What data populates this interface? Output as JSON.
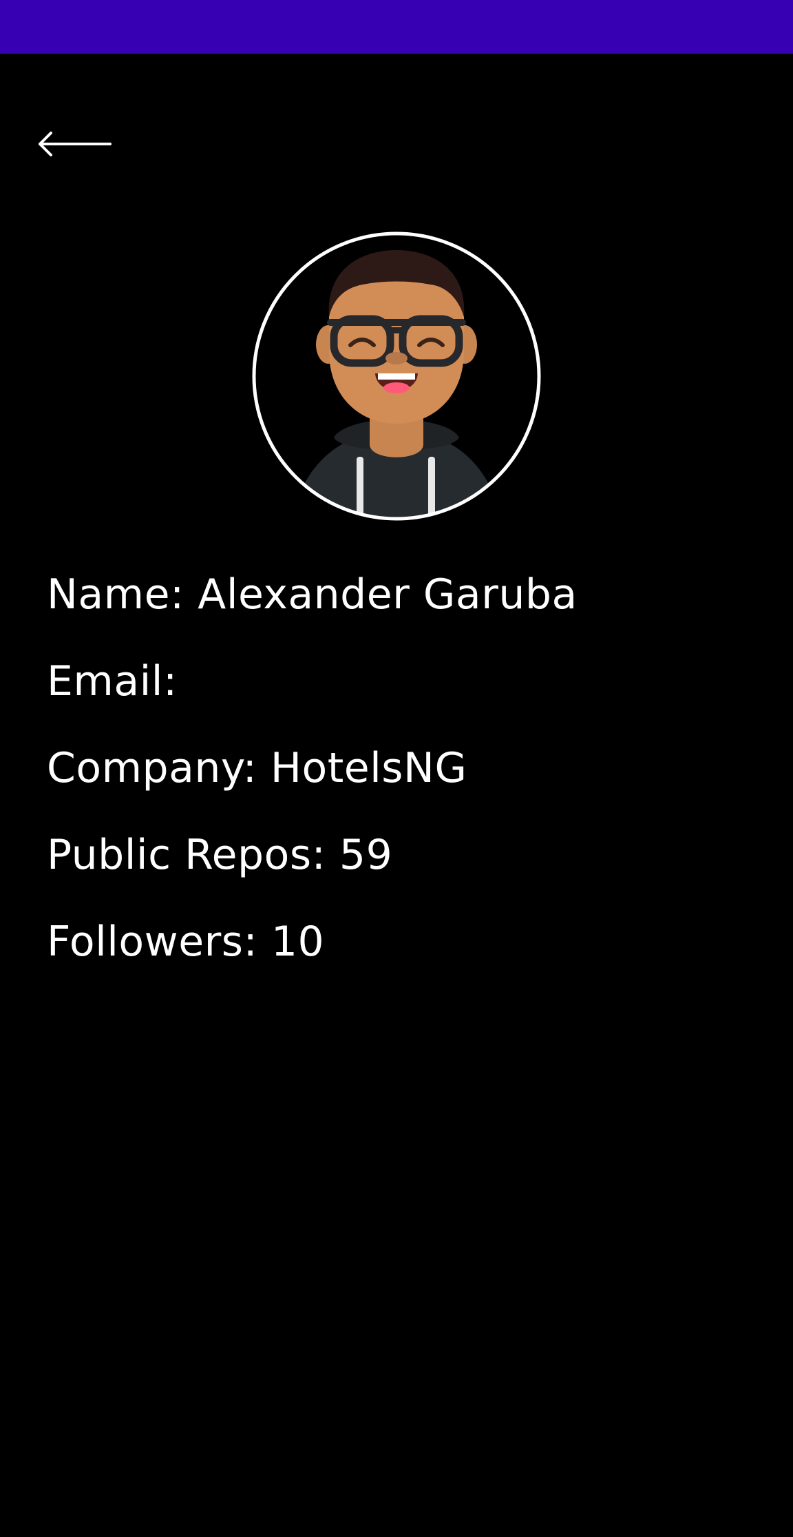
{
  "status_bar": {
    "color": "#3700b3"
  },
  "toolbar": {
    "back_icon": "arrow-left-icon"
  },
  "profile": {
    "avatar_icon": "user-avatar-illustration",
    "name_line": "Name: Alexander Garuba",
    "email_line": "Email:",
    "company_line": "Company: HotelsNG",
    "repos_line": "Public Repos: 59",
    "followers_line": "Followers: 10"
  },
  "theme": {
    "background": "#000000",
    "text": "#ffffff",
    "accent": "#3700b3"
  }
}
